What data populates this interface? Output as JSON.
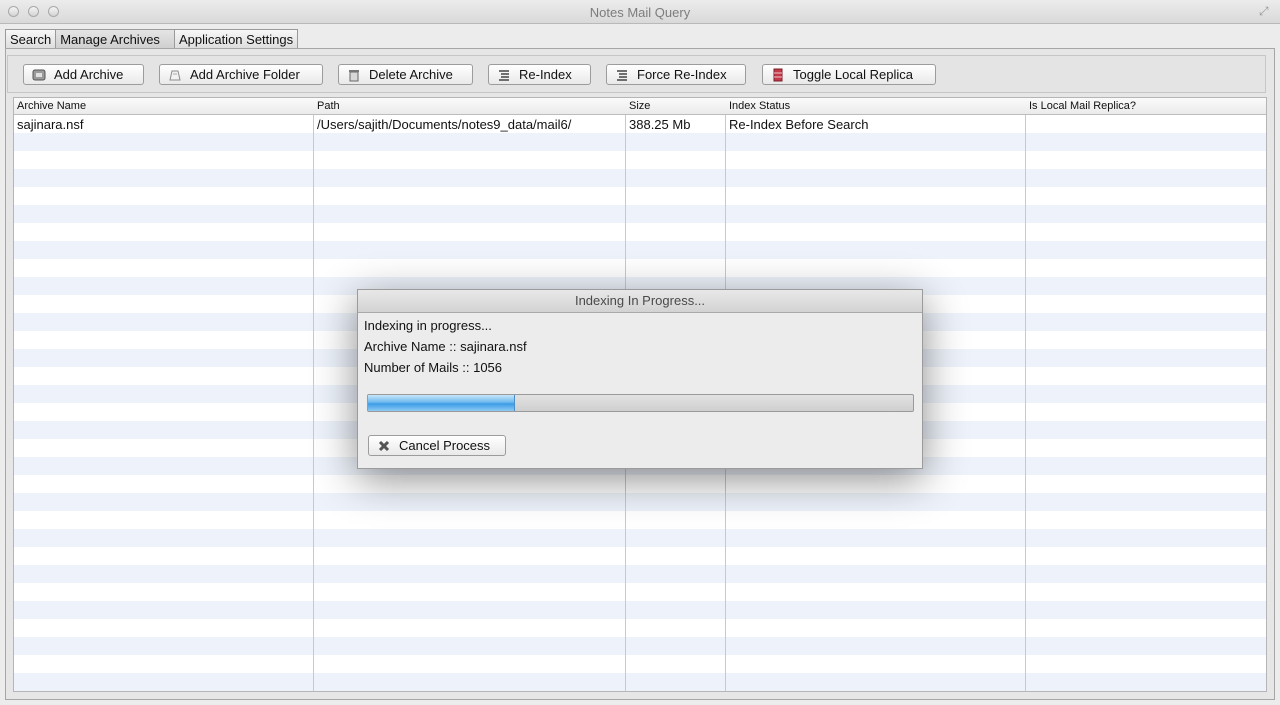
{
  "window": {
    "title": "Notes Mail Query"
  },
  "tabs": [
    {
      "label": "Search"
    },
    {
      "label": "Manage Archives"
    },
    {
      "label": "Application Settings"
    }
  ],
  "toolbar": {
    "add_archive": "Add Archive",
    "add_archive_folder": "Add Archive Folder",
    "delete_archive": "Delete Archive",
    "re_index": "Re-Index",
    "force_re_index": "Force Re-Index",
    "toggle_local_replica": "Toggle Local Replica"
  },
  "table": {
    "columns": [
      "Archive Name",
      "Path",
      "Size",
      "Index Status",
      "Is Local Mail Replica?"
    ],
    "rows": [
      [
        "sajinara.nsf",
        "/Users/sajith/Documents/notes9_data/mail6/",
        "388.25 Mb",
        "Re-Index Before Search",
        ""
      ]
    ]
  },
  "dialog": {
    "title": "Indexing In Progress...",
    "line1": "Indexing in progress...",
    "line2": "Archive Name :: sajinara.nsf",
    "line3": "Number of Mails :: 1056",
    "progress_fraction": 0.27,
    "cancel_label": "Cancel Process"
  },
  "colors": {
    "progress": "#3c9be6",
    "row_stripe": "#eef3fb"
  }
}
